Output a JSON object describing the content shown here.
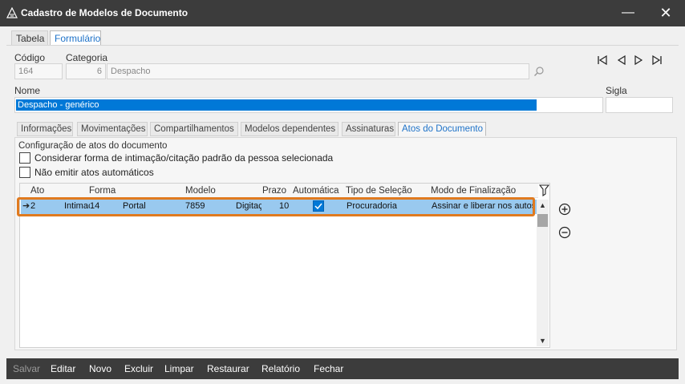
{
  "window": {
    "title": "Cadastro de Modelos de Documento"
  },
  "tabs": [
    {
      "label": "Tabela"
    },
    {
      "label": "Formulário"
    }
  ],
  "form": {
    "codigo_label": "Código",
    "codigo_value": "164",
    "categoria_label": "Categoria",
    "categoria_code": "6",
    "categoria_value": "Despacho",
    "nome_label": "Nome",
    "nome_value": "Despacho - genérico",
    "sigla_label": "Sigla",
    "sigla_value": ""
  },
  "subtabs": [
    {
      "label": "Informações"
    },
    {
      "label": "Movimentações"
    },
    {
      "label": "Compartilhamentos"
    },
    {
      "label": "Modelos dependentes"
    },
    {
      "label": "Assinaturas"
    },
    {
      "label": "Atos do Documento"
    }
  ],
  "atos": {
    "section_title": "Configuração de atos do documento",
    "opt1_label": "Considerar forma de intimação/citação padrão da pessoa selecionada",
    "opt2_label": "Não emitir atos automáticos",
    "columns": [
      "Ato",
      "Forma",
      "Modelo",
      "Prazo",
      "Automática",
      "Tipo de Seleção",
      "Modo de Finalização"
    ],
    "rows": [
      {
        "ato": "2",
        "forma_tipo": "Intimação",
        "forma_codigo": "14",
        "forma_nome": "Portal",
        "modelo_codigo": "7859",
        "modelo_nome": "Digitação",
        "prazo": "10",
        "automatica": true,
        "tipo_selecao": "Procuradoria",
        "modo_finalizacao": "Assinar e liberar nos autos"
      }
    ]
  },
  "statusbar": {
    "salvar": "Salvar",
    "editar": "Editar",
    "novo": "Novo",
    "excluir": "Excluir",
    "limpar": "Limpar",
    "restaurar": "Restaurar",
    "relatorio": "Relatório",
    "fechar": "Fechar"
  },
  "colors": {
    "accent": "#0078d7",
    "selected_row": "#99c9ef",
    "highlight": "#e07a1f",
    "dark_bar": "#3c3c3c"
  }
}
